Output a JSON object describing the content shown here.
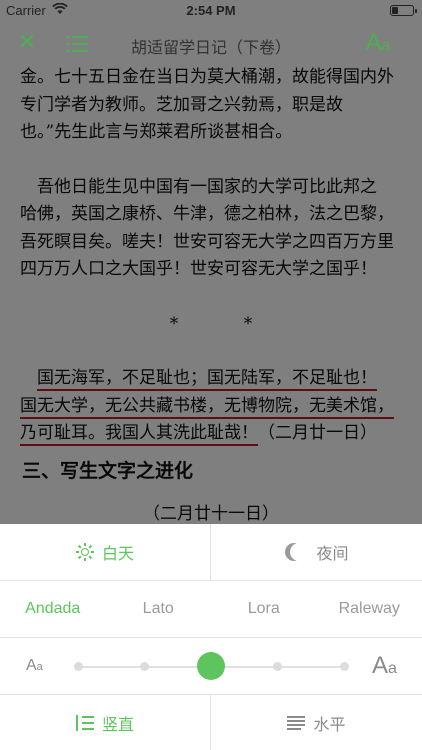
{
  "status": {
    "carrier": "Carrier",
    "time": "2:54 PM",
    "battery_level": 0.3
  },
  "navbar": {
    "title": "胡适留学日记（下卷）",
    "font_button": "A",
    "font_button_small": "a"
  },
  "content": {
    "para1": [
      "金。七十五日金在当日为莫大桶潮，故能得国内外",
      "专门学者为教师。芝加哥之兴勃焉，职是故",
      "也。”先生此言与郑莱君所谈甚相合。"
    ],
    "para2": [
      "　吾他日能生见中国有一国家的大学可比此邦之",
      "哈佛，英国之康桥、牛津，德之柏林，法之巴黎，",
      "吾死瞑目矣。嗟夫！世安可容无大学之四百万方里",
      "四万万人口之大国乎！世安可容无大学之国乎！"
    ],
    "stars": "* *",
    "para3": [
      "国无海军，不足耻也；国无陆军，不足耻也！",
      "国无大学，无公共藏书楼，无博物院，无美术馆，",
      "乃可耻耳。我国人其洗此耻哉！"
    ],
    "para3_suffix": "（二月廿一日）",
    "heading": "三、写生文字之进化",
    "date": "（二月廿十一日）"
  },
  "panel": {
    "day_label": "白天",
    "night_label": "夜间",
    "fonts": [
      "Andada",
      "Lato",
      "Lora",
      "Raleway"
    ],
    "active_font": "Andada",
    "size_small": {
      "big": "A",
      "small": "a"
    },
    "size_large": {
      "big": "A",
      "small": "a"
    },
    "size_level": 0.5,
    "vertical_label": "竖直",
    "horizontal_label": "水平"
  },
  "colors": {
    "accent": "#5ec55e",
    "underline": "#b81d24"
  }
}
